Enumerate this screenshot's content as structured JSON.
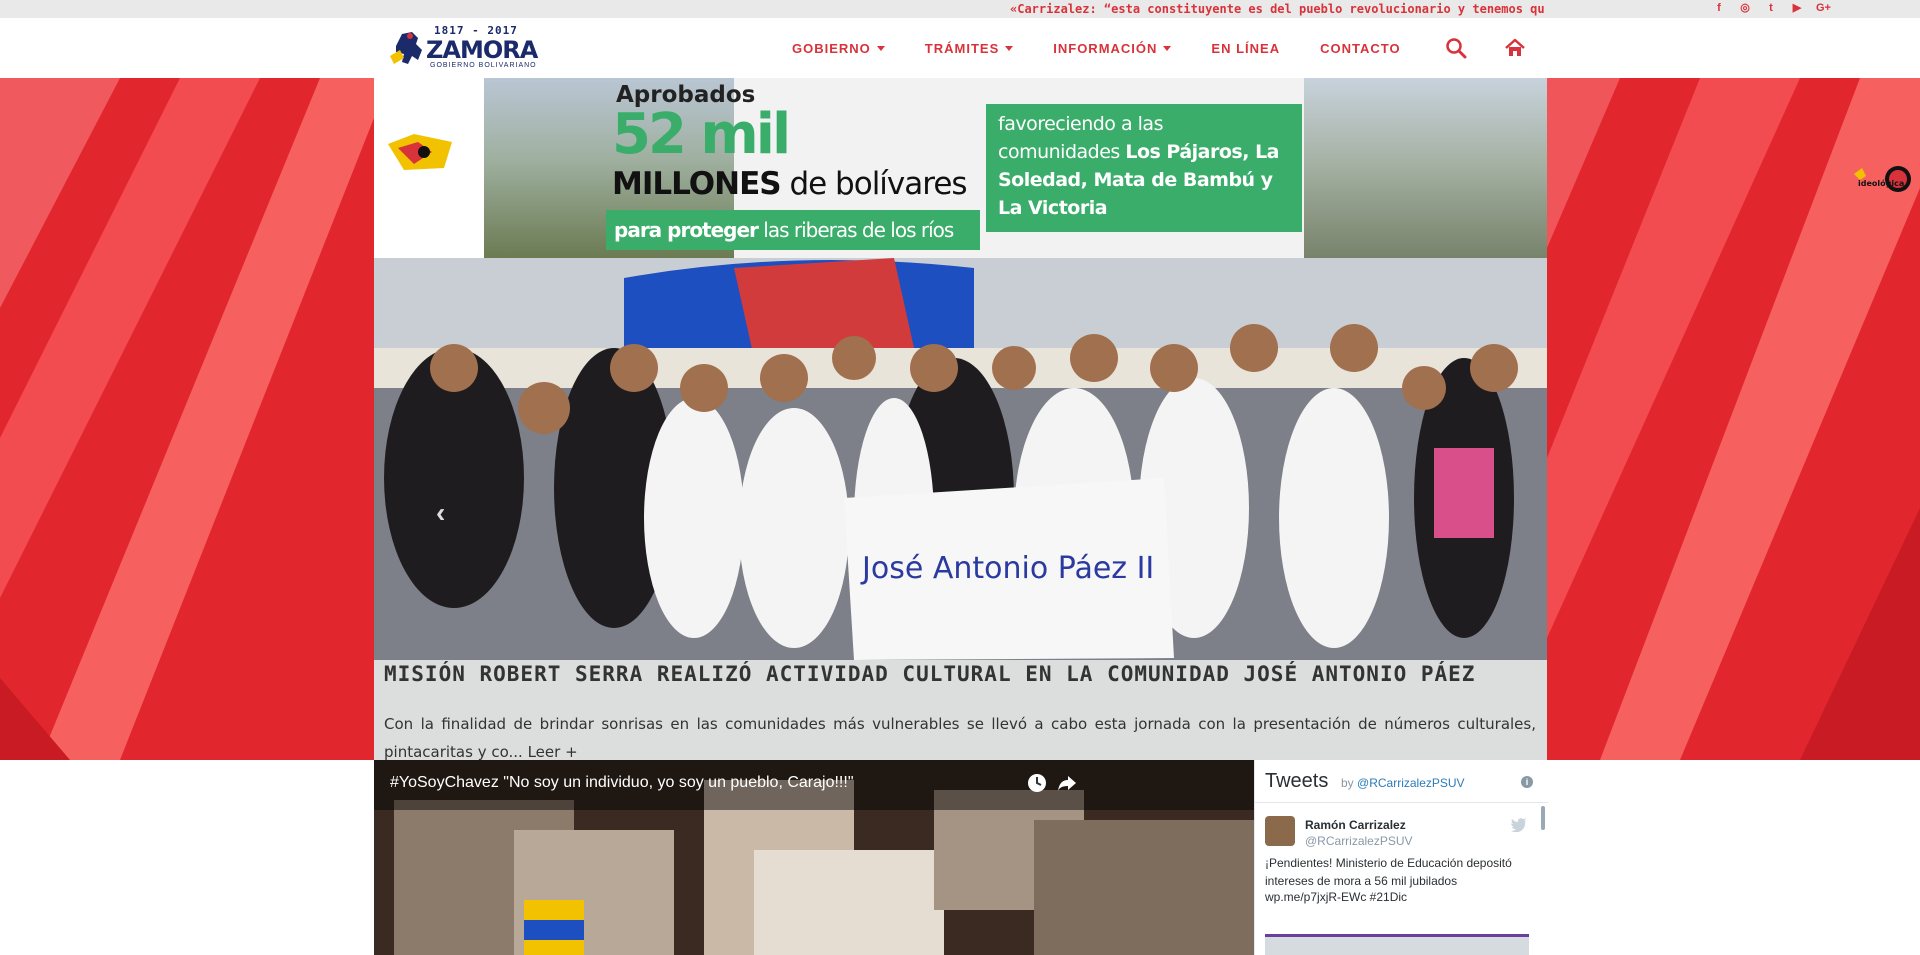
{
  "topbar": {
    "ticker": "«Carrizalez: “esta constituyente es del pueblo revolucionario y tenemos qu",
    "social": [
      {
        "icon": "facebook-icon",
        "glyph": "f"
      },
      {
        "icon": "instagram-icon",
        "glyph": "◎"
      },
      {
        "icon": "twitter-icon",
        "glyph": "t"
      },
      {
        "icon": "youtube-icon",
        "glyph": "▶"
      },
      {
        "icon": "google-plus-icon",
        "glyph": "G+"
      }
    ]
  },
  "logo": {
    "years": "1817 - 2017",
    "name": "ZAMORA",
    "tagline": "GOBIERNO BOLIVARIANO"
  },
  "nav": {
    "items": [
      {
        "label": "GOBIERNO",
        "dropdown": true
      },
      {
        "label": "TRÁMITES",
        "dropdown": true
      },
      {
        "label": "INFORMACIÓN",
        "dropdown": true
      },
      {
        "label": "EN LÍNEA",
        "dropdown": false
      },
      {
        "label": "CONTACTO",
        "dropdown": false
      }
    ],
    "search_icon": "search-icon",
    "home_icon": "home-icon",
    "accent": "#d8323a"
  },
  "banner": {
    "line1": "Aprobados",
    "line2": "52 mil",
    "line3_bold": "MILLONES",
    "line3_rest": " de bolívares",
    "line4_bold": "para proteger",
    "line4_rest": " las riberas de los ríos",
    "box_plain": "favoreciendo a las comunidades ",
    "box_bold": "Los Pájaros, La Soledad,  Mata de Bambú y La Victoria",
    "green": "#3aad6b"
  },
  "slider": {
    "title": "Misión Robert Serra realizó actividad cultural en la comunidad José Antonio Páez",
    "text": "Con la finalidad de brindar sonrisas en las comunidades más vulnerables se llevó a cabo esta jornada con la presentación de números culturales, pintacaritas y co...",
    "read_more": "Leer +",
    "prev_glyph": "‹",
    "sign_text": "José Antonio Páez II"
  },
  "right_logo": "ideológica",
  "video": {
    "title": "#YoSoyChavez \"No soy un individuo, yo soy un pueblo, Carajo!!!\""
  },
  "tweets": {
    "header": "Tweets",
    "by": "by ",
    "by_handle": "@RCarrizalezPSUV",
    "info": "i",
    "user_name": "Ramón Carrizalez",
    "user_handle": "@RCarrizalezPSUV",
    "text": "¡Pendientes! Ministerio de Educación depositó intereses de mora a 56 mil jubilados",
    "link": "wp.me/p7jxjR-EWc #21Dic"
  }
}
